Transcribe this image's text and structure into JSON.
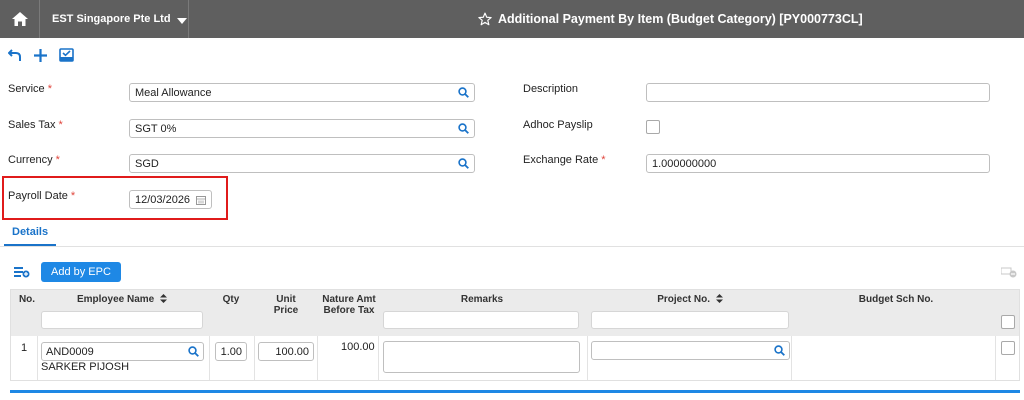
{
  "header": {
    "company": "EST Singapore Pte Ltd",
    "title": "Additional Payment By Item (Budget Category) [PY000773CL]"
  },
  "form": {
    "service_label": "Service",
    "service_value": "Meal Allowance",
    "sales_tax_label": "Sales Tax",
    "sales_tax_value": "SGT 0%",
    "currency_label": "Currency",
    "currency_value": "SGD",
    "payroll_date_label": "Payroll Date",
    "payroll_date_value": "12/03/2026",
    "description_label": "Description",
    "description_value": "",
    "adhoc_label": "Adhoc Payslip",
    "exchange_rate_label": "Exchange Rate",
    "exchange_rate_value": "1.000000000",
    "required_mark": "*"
  },
  "tabs": {
    "details": "Details"
  },
  "grid": {
    "add_by_epc": "Add by EPC",
    "columns": {
      "no": "No.",
      "employee": "Employee Name",
      "qty": "Qty",
      "unit_price_1": "Unit",
      "unit_price_2": "Price",
      "nature_1": "Nature Amt",
      "nature_2": "Before Tax",
      "remarks": "Remarks",
      "project": "Project No.",
      "budget": "Budget Sch No."
    },
    "rows": [
      {
        "no": "1",
        "employee_code": "AND0009",
        "employee_name": "SARKER PIJOSH",
        "qty": "1.00",
        "unit_price": "100.00",
        "nature_amt": "100.00",
        "remarks": "",
        "project": ""
      }
    ]
  },
  "colors": {
    "accent": "#1a73c9",
    "topbar": "#5f5f5f",
    "highlight": "#e01b1b"
  }
}
